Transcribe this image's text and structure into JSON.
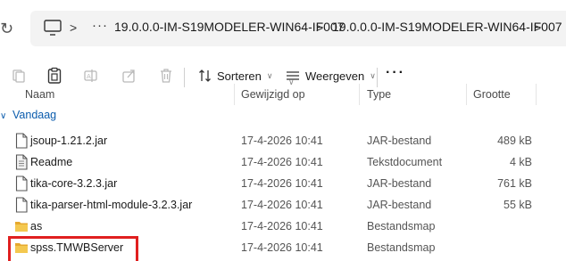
{
  "address_bar": {
    "icons": {
      "refresh": "refresh-icon",
      "computer": "computer-icon",
      "more_path": "ellipsis-icon"
    },
    "separator": ">",
    "ellipsis": "···",
    "crumbs": [
      "19.0.0.0-IM-S19MODELER-WIN64-IF007",
      "19.0.0.0-IM-S19MODELER-WIN64-IF007"
    ]
  },
  "toolbar": {
    "icons": [
      "new-item-icon",
      "paste-icon",
      "rename-icon",
      "share-icon",
      "delete-icon"
    ],
    "sort_label": "Sorteren",
    "view_label": "Weergeven",
    "more_label": "···"
  },
  "columns": {
    "name": "Naam",
    "modified": "Gewijzigd op",
    "type": "Type",
    "size": "Grootte"
  },
  "group": {
    "label": "Vandaag",
    "arrow": "∨"
  },
  "files": [
    {
      "name": "jsoup-1.21.2.jar",
      "date": "17-4-2026 10:41",
      "type": "JAR-bestand",
      "size": "489 kB",
      "icon": "file-icon"
    },
    {
      "name": "Readme",
      "date": "17-4-2026 10:41",
      "type": "Tekstdocument",
      "size": "4 kB",
      "icon": "text-file-icon"
    },
    {
      "name": "tika-core-3.2.3.jar",
      "date": "17-4-2026 10:41",
      "type": "JAR-bestand",
      "size": "761 kB",
      "icon": "file-icon"
    },
    {
      "name": "tika-parser-html-module-3.2.3.jar",
      "date": "17-4-2026 10:41",
      "type": "JAR-bestand",
      "size": "55 kB",
      "icon": "file-icon"
    },
    {
      "name": "as",
      "date": "17-4-2026 10:41",
      "type": "Bestandsmap",
      "size": "",
      "icon": "folder-icon"
    },
    {
      "name": "spss.TMWBServer",
      "date": "17-4-2026 10:41",
      "type": "Bestandsmap",
      "size": "",
      "icon": "folder-icon"
    }
  ],
  "colors": {
    "accent": "#0b5cad",
    "highlight_border": "#e01f1f",
    "folder": "#f2c14e"
  }
}
